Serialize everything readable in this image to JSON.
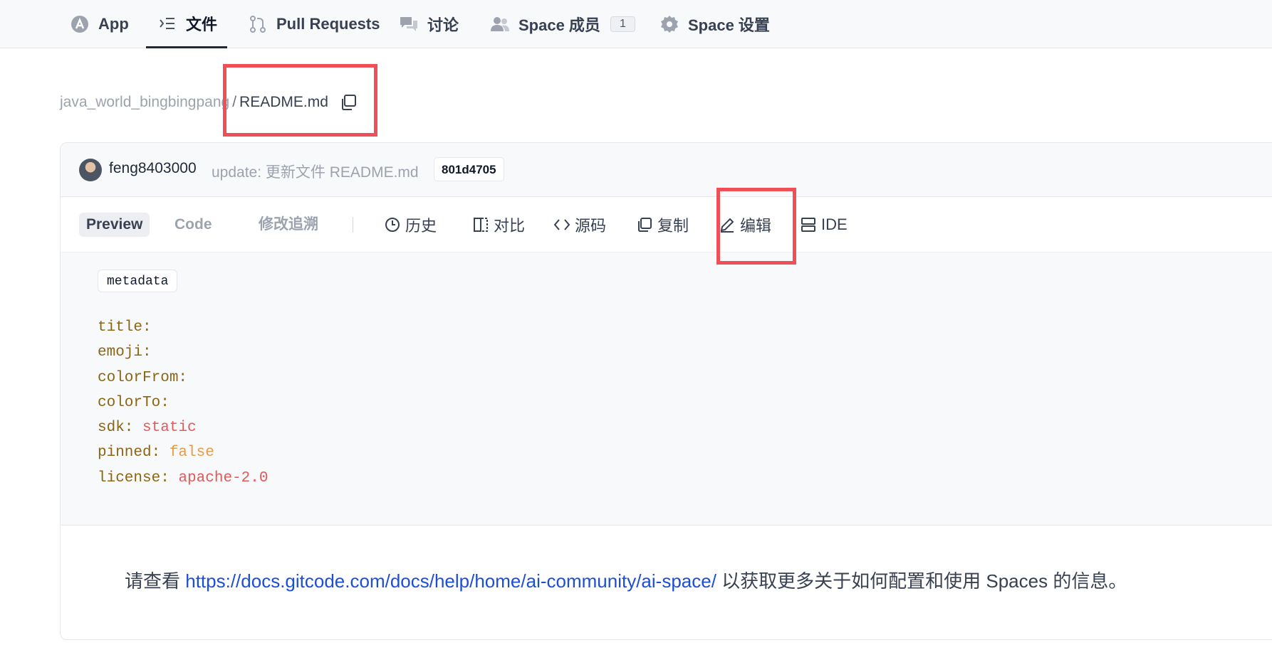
{
  "nav": {
    "tabs": [
      {
        "label": "App",
        "icon": "app-icon"
      },
      {
        "label": "文件",
        "icon": "file-list-icon",
        "active": true
      },
      {
        "label": "Pull Requests",
        "icon": "pull-request-icon"
      },
      {
        "label": "讨论",
        "icon": "discussion-icon"
      },
      {
        "label": "Space 成员",
        "icon": "members-icon",
        "badge": "1"
      },
      {
        "label": "Space 设置",
        "icon": "gear-icon"
      }
    ]
  },
  "breadcrumb": {
    "repo": "java_world_bingbingpang",
    "separator": "/",
    "file": "README.md"
  },
  "commit": {
    "author": "feng8403000",
    "message": "update: 更新文件 README.md",
    "hash": "801d4705"
  },
  "view_tabs": [
    "Preview",
    "Code",
    "修改追溯"
  ],
  "actions": [
    {
      "label": "历史",
      "icon": "clock-icon"
    },
    {
      "label": "对比",
      "icon": "compare-icon"
    },
    {
      "label": "源码",
      "icon": "code-icon"
    },
    {
      "label": "复制",
      "icon": "copy-icon"
    },
    {
      "label": "编辑",
      "icon": "pencil-icon"
    },
    {
      "label": "IDE",
      "icon": "ide-icon"
    }
  ],
  "metadata": {
    "chip": "metadata",
    "lines": [
      {
        "key": "title:",
        "value": ""
      },
      {
        "key": "emoji:",
        "value": ""
      },
      {
        "key": "colorFrom:",
        "value": ""
      },
      {
        "key": "colorTo:",
        "value": ""
      },
      {
        "key": "sdk:",
        "value": "static"
      },
      {
        "key": "pinned:",
        "value": "false"
      },
      {
        "key": "license:",
        "value": "apache-2.0"
      }
    ]
  },
  "readme": {
    "prefix": "请查看 ",
    "link": "https://docs.gitcode.com/docs/help/home/ai-community/ai-space/",
    "suffix": " 以获取更多关于如何配置和使用 Spaces 的信息。"
  },
  "colors": {
    "highlight": "#ef4f57",
    "link": "#1d4ed8",
    "yaml_key": "#8a6513",
    "yaml_string": "#e05a5a",
    "yaml_bool": "#e79a4a"
  }
}
